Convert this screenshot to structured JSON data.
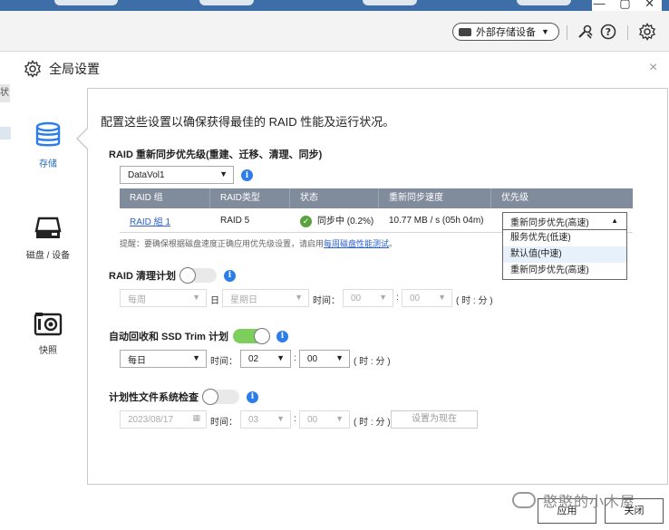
{
  "window": {
    "controls": "— ▢ ✕"
  },
  "toolbar": {
    "external_storage_label": "外部存储设备",
    "icons": [
      "tools-icon",
      "help-icon",
      "settings-icon"
    ]
  },
  "dialog": {
    "title": "全局设置",
    "close": "×",
    "edge_text": "状"
  },
  "nav": {
    "items": [
      {
        "label": "存储",
        "icon": "database-icon",
        "active": true
      },
      {
        "label": "磁盘 / 设备",
        "icon": "disk-icon",
        "active": false
      },
      {
        "label": "快照",
        "icon": "camera-icon",
        "active": false
      }
    ]
  },
  "main": {
    "intro": "配置这些设置以确保获得最佳的 RAID 性能及运行状况。",
    "resync": {
      "title": "RAID 重新同步优先级(重建、迁移、清理、同步)",
      "volume_select": "DataVol1",
      "columns": [
        "RAID 组",
        "RAID类型",
        "状态",
        "重新同步速度",
        "优先级"
      ],
      "row": {
        "group": "RAID 組 1",
        "type": "RAID 5",
        "status": "同步中 (0.2%)",
        "speed": "10.77 MB / s (05h 04m)",
        "priority": "重新同步优先(高速)"
      },
      "priority_options": [
        "服务优先(低速)",
        "默认值(中速)",
        "重新同步优先(高速)"
      ],
      "hint_prefix": "提醒：要确保根据磁盘速度正确应用优先级设置，请启用",
      "hint_link": "每周磁盘性能测试",
      "hint_suffix": "。"
    },
    "scrub": {
      "title": "RAID 清理计划",
      "enabled": false,
      "freq": "每周",
      "day_label": "日",
      "day": "星期日",
      "time_label": "时间：",
      "hour": "00",
      "colon": ":",
      "minute": "00",
      "unit": "( 时 : 分 )"
    },
    "trim": {
      "title": "自动回收和 SSD Trim 计划",
      "enabled": true,
      "freq": "每日",
      "time_label": "时间：",
      "hour": "02",
      "colon": ":",
      "minute": "00",
      "unit": "( 时 : 分 )"
    },
    "fscheck": {
      "title": "计划性文件系统检查",
      "enabled": false,
      "date": "2023/08/17",
      "time_label": "时间：",
      "hour": "03",
      "colon": ":",
      "minute": "00",
      "unit": "( 时 : 分 )",
      "set_now": "设置为现在"
    }
  },
  "footer": {
    "apply": "应用",
    "close": "关闭"
  },
  "watermark": "憨憨的小木屋",
  "colors": {
    "accent": "#2b7de9",
    "toggle_on": "#7ccf5b",
    "table_header": "#808b9b",
    "ok_green": "#5aa23e",
    "link": "#2b5fc8"
  }
}
